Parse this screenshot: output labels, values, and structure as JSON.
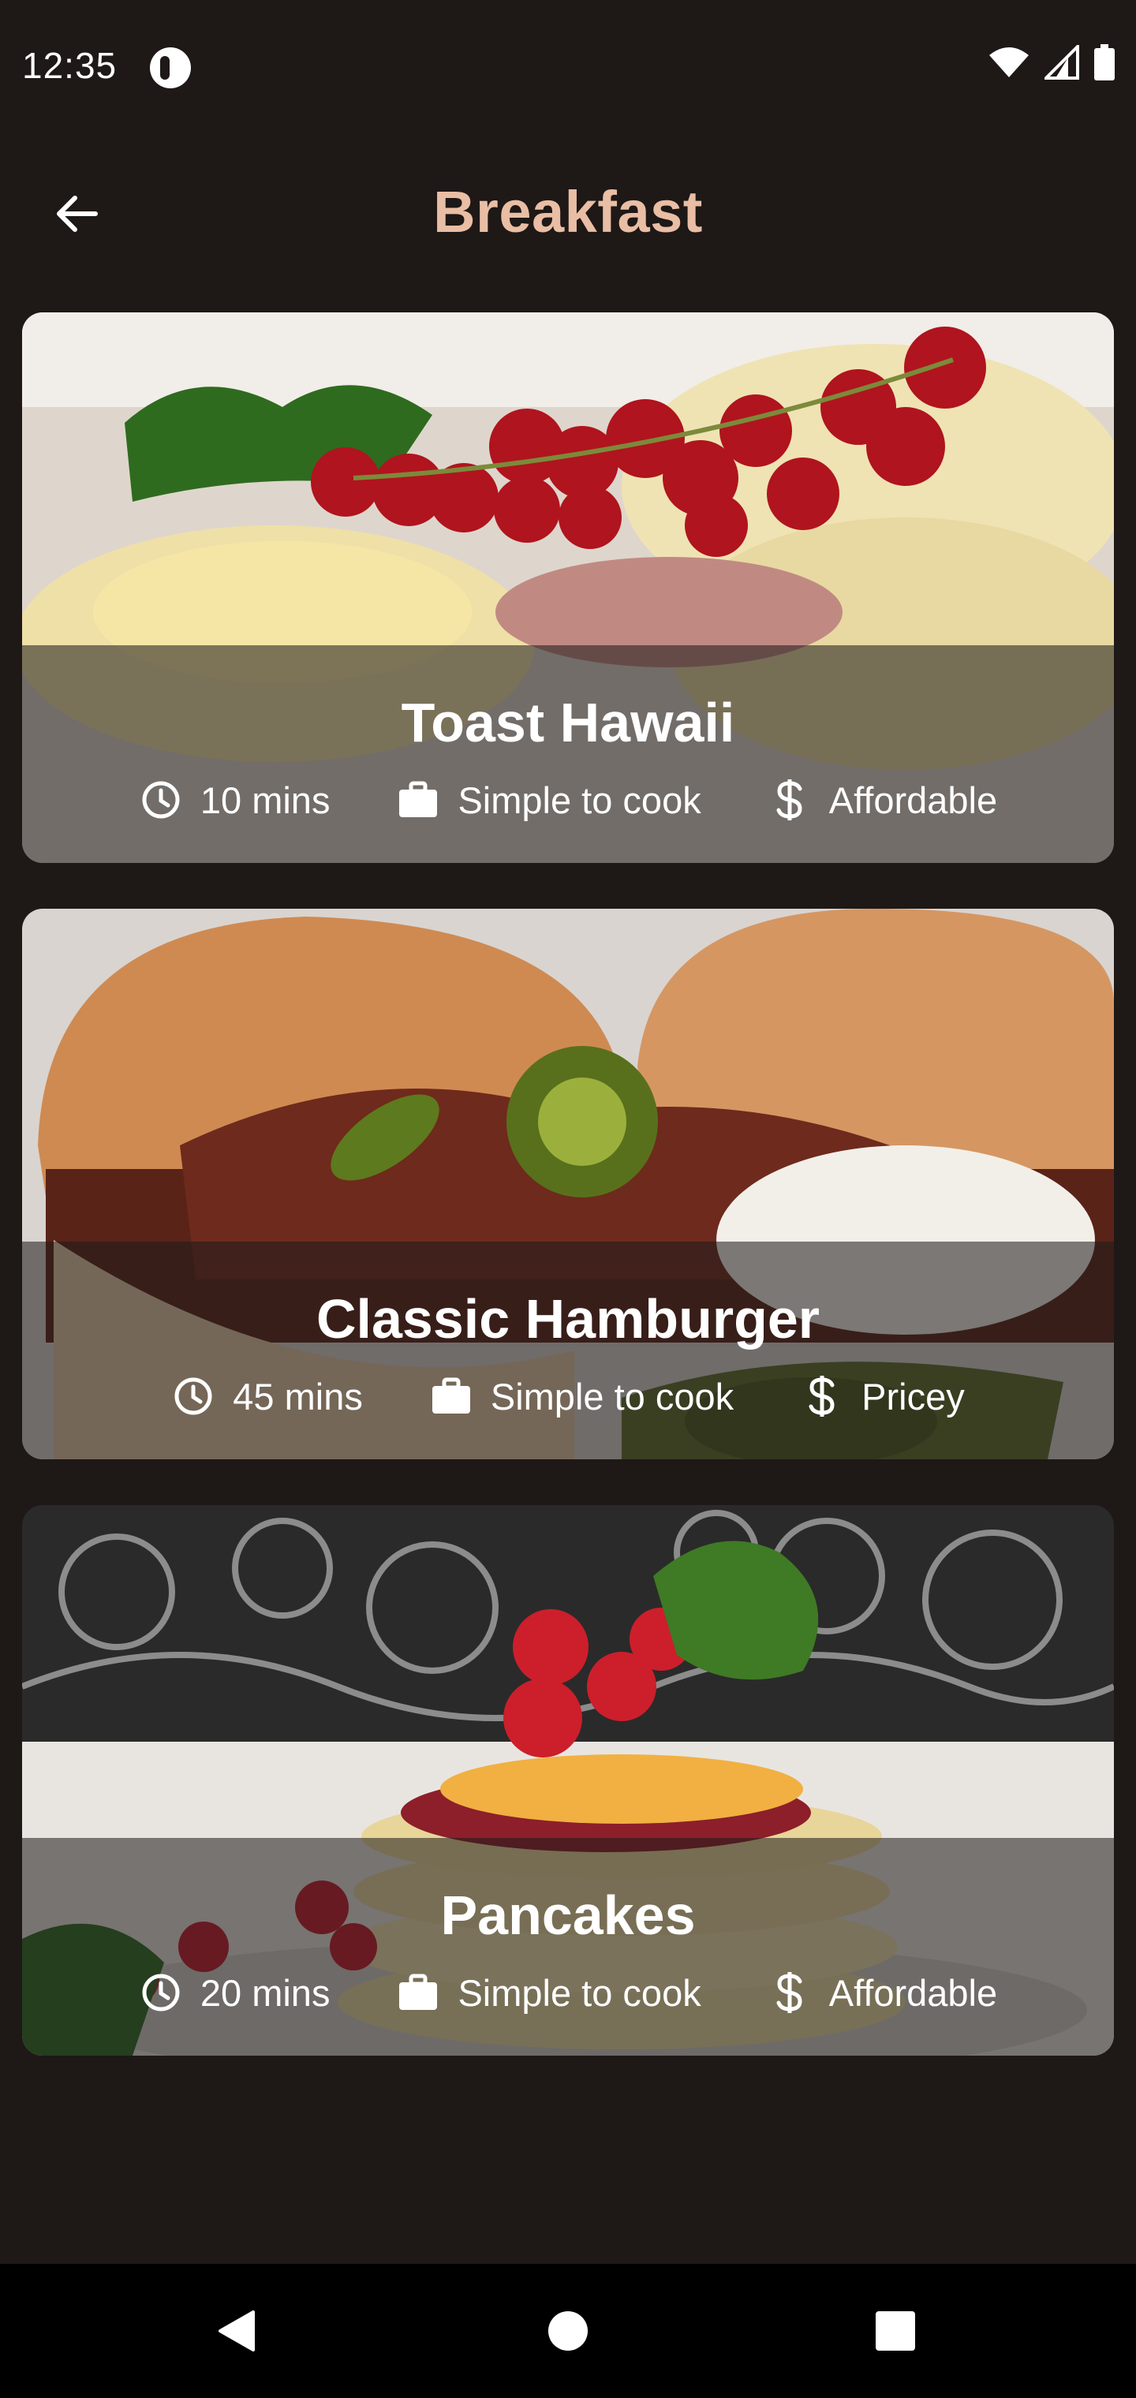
{
  "status_bar": {
    "time": "12:35",
    "icons": [
      "app-notification-icon",
      "wifi-icon",
      "cellular-signal-icon",
      "battery-icon"
    ]
  },
  "app_bar": {
    "title": "Breakfast",
    "back_icon": "arrow-back-icon"
  },
  "meals": [
    {
      "title": "Toast Hawaii",
      "duration": "10 mins",
      "complexity": "Simple to cook",
      "affordability": "Affordable"
    },
    {
      "title": "Classic Hamburger",
      "duration": "45 mins",
      "complexity": "Simple to cook",
      "affordability": "Pricey"
    },
    {
      "title": "Pancakes",
      "duration": "20 mins",
      "complexity": "Simple to cook",
      "affordability": "Affordable"
    }
  ],
  "meta_icons": {
    "duration": "clock-icon",
    "complexity": "work-bag-icon",
    "affordability": "dollar-icon"
  },
  "nav_bar": {
    "buttons": [
      "back-triangle-icon",
      "home-circle-icon",
      "recents-square-icon"
    ]
  },
  "colors": {
    "background": "#1e1817",
    "title_accent": "#e9bea4",
    "overlay": "rgba(30,27,27,0.56)",
    "text": "#ffffff"
  }
}
